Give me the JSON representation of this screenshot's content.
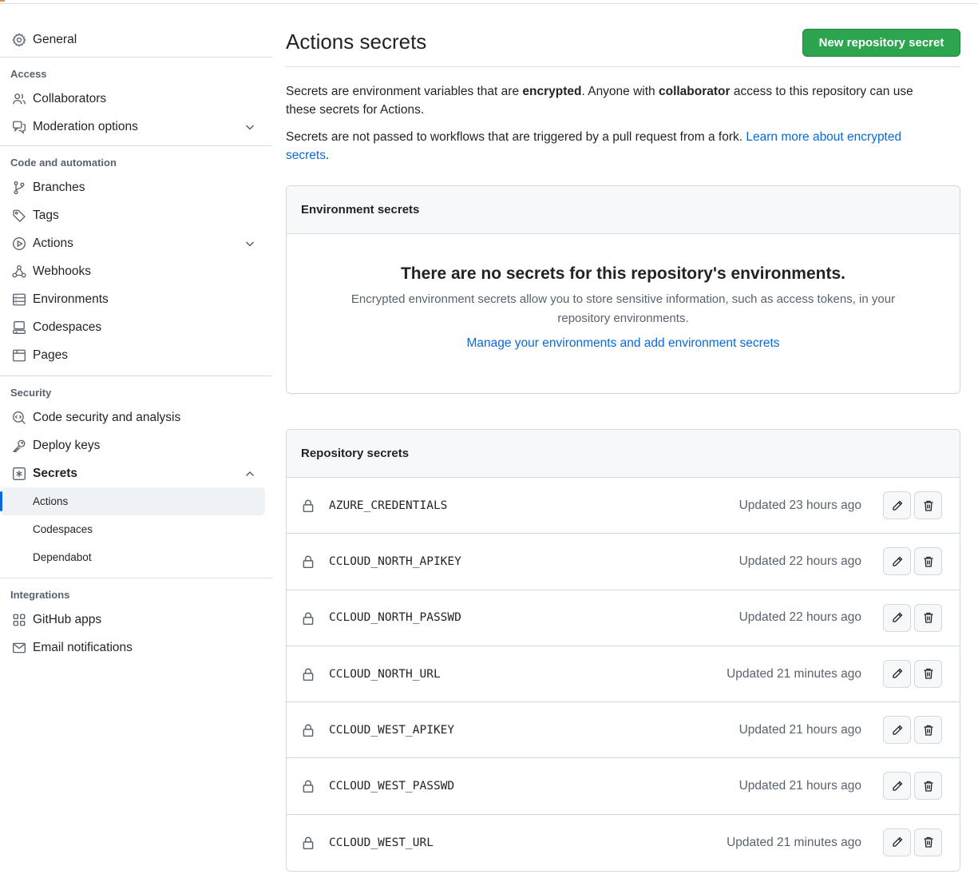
{
  "sidebar": {
    "general": "General",
    "access_heading": "Access",
    "collaborators": "Collaborators",
    "moderation": "Moderation options",
    "code_heading": "Code and automation",
    "branches": "Branches",
    "tags": "Tags",
    "actions": "Actions",
    "webhooks": "Webhooks",
    "environments": "Environments",
    "codespaces": "Codespaces",
    "pages": "Pages",
    "security_heading": "Security",
    "code_security": "Code security and analysis",
    "deploy_keys": "Deploy keys",
    "secrets": "Secrets",
    "secrets_sub": [
      "Actions",
      "Codespaces",
      "Dependabot"
    ],
    "integrations_heading": "Integrations",
    "github_apps": "GitHub apps",
    "email_notifications": "Email notifications"
  },
  "header": {
    "title": "Actions secrets",
    "new_button": "New repository secret"
  },
  "intro": {
    "p1_a": "Secrets are environment variables that are ",
    "p1_b": "encrypted",
    "p1_c": ". Anyone with ",
    "p1_d": "collaborator",
    "p1_e": " access to this repository can use these secrets for Actions.",
    "p2_a": "Secrets are not passed to workflows that are triggered by a pull request from a fork. ",
    "p2_link": "Learn more about encrypted secrets",
    "p2_end": "."
  },
  "env_secrets": {
    "heading": "Environment secrets",
    "empty_title": "There are no secrets for this repository's environments.",
    "empty_desc": "Encrypted environment secrets allow you to store sensitive information, such as access tokens, in your repository environments.",
    "manage_link": "Manage your environments and add environment secrets"
  },
  "repo_secrets": {
    "heading": "Repository secrets",
    "items": [
      {
        "name": "AZURE_CREDENTIALS",
        "updated": "Updated 23 hours ago"
      },
      {
        "name": "CCLOUD_NORTH_APIKEY",
        "updated": "Updated 22 hours ago"
      },
      {
        "name": "CCLOUD_NORTH_PASSWD",
        "updated": "Updated 22 hours ago"
      },
      {
        "name": "CCLOUD_NORTH_URL",
        "updated": "Updated 21 minutes ago"
      },
      {
        "name": "CCLOUD_WEST_APIKEY",
        "updated": "Updated 21 hours ago"
      },
      {
        "name": "CCLOUD_WEST_PASSWD",
        "updated": "Updated 21 hours ago"
      },
      {
        "name": "CCLOUD_WEST_URL",
        "updated": "Updated 21 minutes ago"
      }
    ]
  },
  "colors": {
    "accent": "#0969da",
    "primary_button": "#2da44e",
    "muted": "#59636e",
    "border": "#d1d9e0"
  }
}
